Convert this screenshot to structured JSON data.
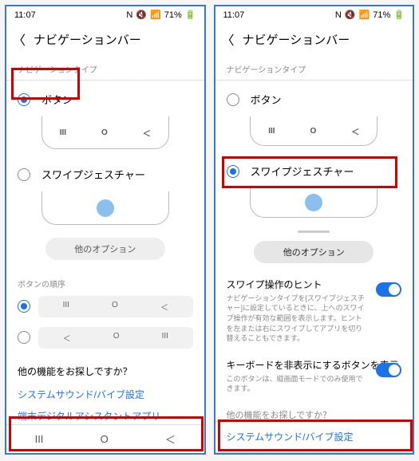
{
  "status": {
    "time": "11:07",
    "batt": "71%",
    "sigText": "⟳☒ 📶 71% 🔋"
  },
  "header": {
    "title": "ナビゲーションバー"
  },
  "section": {
    "navtype": "ナビゲーションタイプ",
    "order": "ボタンの順序"
  },
  "options": {
    "button": "ボタン",
    "swipe": "スワイプジェスチャー"
  },
  "navIcons": {
    "recent": "III",
    "home": "O",
    "back": "＜"
  },
  "otherOptions": "他のオプション",
  "footer": {
    "question": "他の機能をお探しですか？",
    "link": "システムサウンド/バイブ設定",
    "link2": "端末デジタルアシスタントアプリ"
  },
  "right": {
    "swipeHint": {
      "title": "スワイプ操作のヒント",
      "desc": "ナビゲーションタイプを[スワイプジェスチャー]に設定しているときに、上へのスワイプ操作が有効な範囲を表示します。ヒントを左または右にスワイプしてアプリを切り替えることもできます。"
    },
    "hideKb": {
      "title": "キーボードを非表示にするボタンを表示",
      "desc": "このボタンは、縦画面モードでのみ使用できます。"
    },
    "truncated": "他の機能をお探しですか？"
  }
}
